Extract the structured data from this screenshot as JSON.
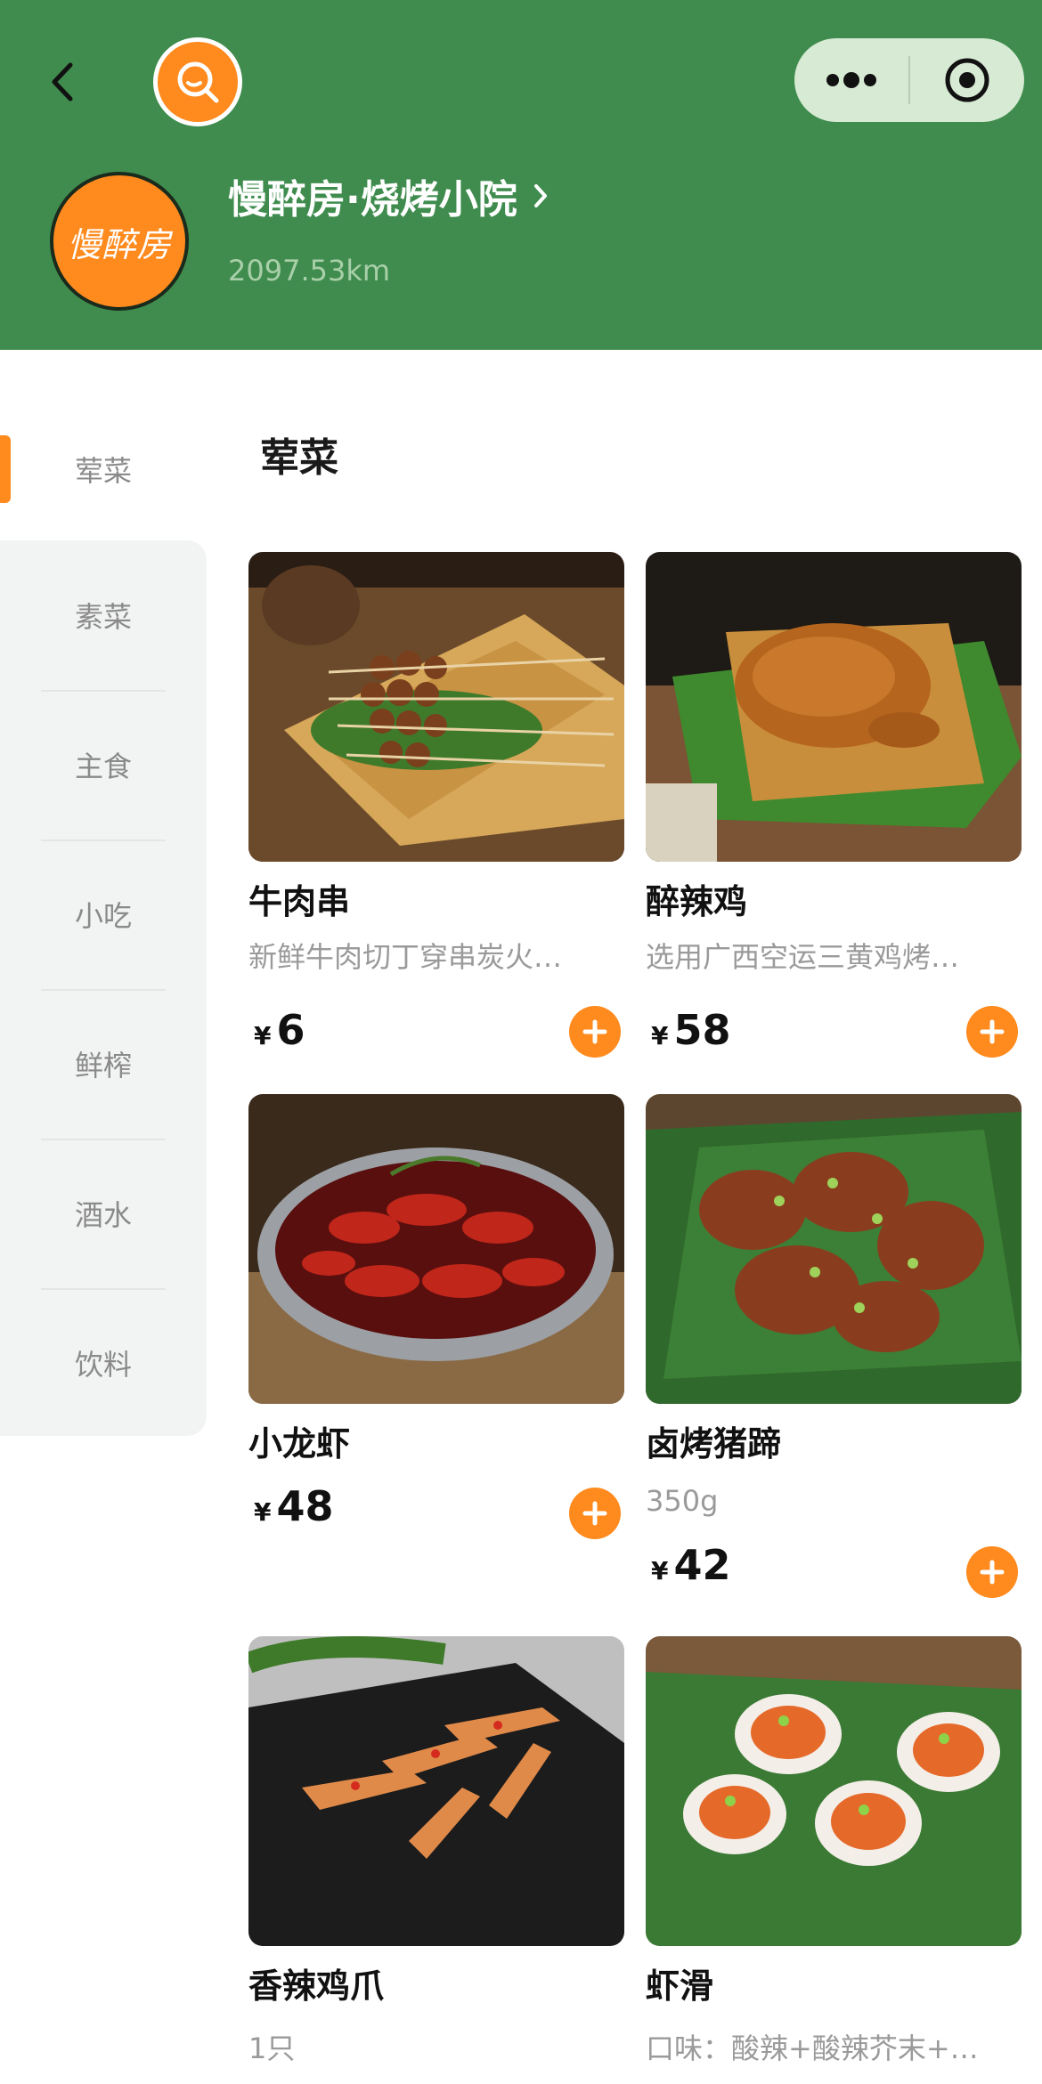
{
  "header": {
    "store_name": "慢醉房·烧烤小院",
    "distance": "2097.53km",
    "logo_text": "慢醉房"
  },
  "sidebar": {
    "items": [
      {
        "label": "荤菜",
        "active": true
      },
      {
        "label": "素菜"
      },
      {
        "label": "主食"
      },
      {
        "label": "小吃"
      },
      {
        "label": "鲜榨"
      },
      {
        "label": "酒水"
      },
      {
        "label": "饮料"
      }
    ]
  },
  "section": {
    "title": "荤菜"
  },
  "products": [
    {
      "name": "牛肉串",
      "desc": "新鲜牛肉切丁穿串炭火…",
      "currency": "¥",
      "price": "6"
    },
    {
      "name": "醉辣鸡",
      "desc": "选用广西空运三黄鸡烤…",
      "currency": "¥",
      "price": "58"
    },
    {
      "name": "小龙虾",
      "desc": "",
      "currency": "¥",
      "price": "48"
    },
    {
      "name": "卤烤猪蹄",
      "desc": "350g",
      "currency": "¥",
      "price": "42"
    },
    {
      "name": "香辣鸡爪",
      "desc": "1只",
      "currency": "¥",
      "price": ""
    },
    {
      "name": "虾滑",
      "desc": "口味：酸辣+酸辣芥末+…",
      "currency": "¥",
      "price": ""
    }
  ],
  "colors": {
    "header_bg": "#3f8c4e",
    "accent": "#ff8a1e",
    "sidebar_bg": "#f2f4f3"
  },
  "icons": [
    "back-icon",
    "search-icon",
    "more-dots-icon",
    "target-icon",
    "chevron-right-icon",
    "plus-icon"
  ]
}
